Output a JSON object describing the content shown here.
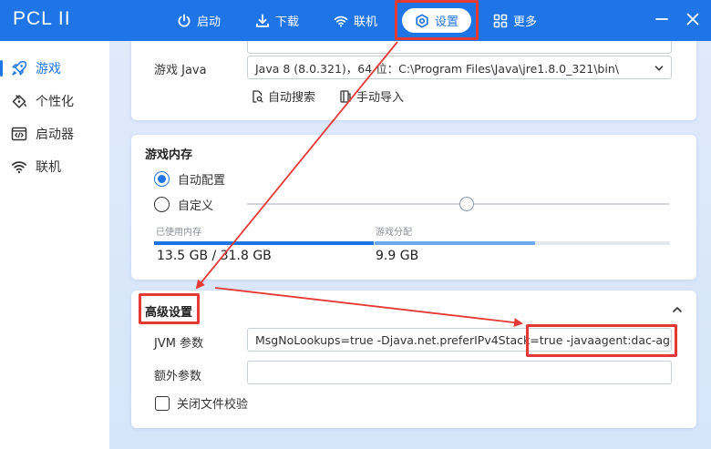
{
  "app": {
    "title": "PCL II"
  },
  "nav": {
    "launch": "启动",
    "download": "下载",
    "online": "联机",
    "settings": "设置",
    "more": "更多"
  },
  "sidebar": {
    "items": [
      {
        "label": "游戏",
        "icon": "rocket-icon",
        "active": true
      },
      {
        "label": "个性化",
        "icon": "palette-icon",
        "active": false
      },
      {
        "label": "启动器",
        "icon": "code-window-icon",
        "active": false
      },
      {
        "label": "联机",
        "icon": "wifi-icon",
        "active": false
      }
    ]
  },
  "java": {
    "label": "游戏 Java",
    "selected": "Java 8 (8.0.321)，64 位：C:\\Program Files\\Java\\jre1.8.0_321\\bin\\",
    "auto_search": "自动搜索",
    "manual_import": "手动导入"
  },
  "memory": {
    "title": "游戏内存",
    "option_auto": "自动配置",
    "option_custom": "自定义",
    "selected_option": "auto",
    "used_label": "已使用内存",
    "used_value": "13.5 GB / 31.8 GB",
    "alloc_label": "游戏分配",
    "alloc_value": "9.9 GB",
    "slider_level": 0.52,
    "used_fraction": 0.425,
    "alloc_fraction": 0.311
  },
  "advanced": {
    "title": "高级设置",
    "jvm_label": "JVM 参数",
    "jvm_value": "MsgNoLookups=true -Djava.net.preferIPv4Stack=true -javaagent:dac-agent.jar",
    "extra_label": "额外参数",
    "extra_value": "",
    "disable_check_label": "关闭文件校验",
    "disable_check_checked": false
  },
  "colors": {
    "accent": "#1f74e6",
    "highlight": "#e53935",
    "alloc_bar": "#6aa8f0"
  }
}
